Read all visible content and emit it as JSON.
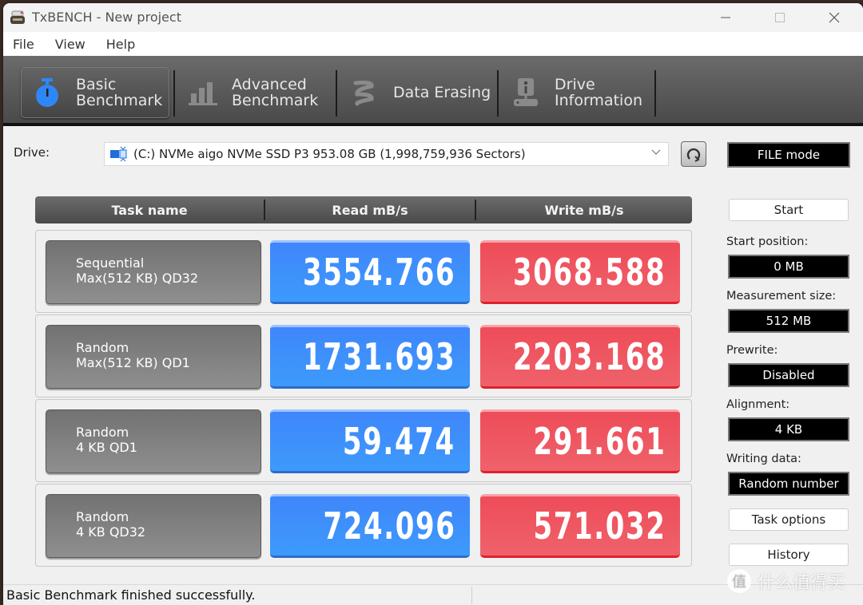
{
  "window": {
    "title": "TxBENCH - New project",
    "controls": {
      "minimize": "—",
      "maximize": "☐",
      "close": "✕"
    }
  },
  "menu": [
    "File",
    "View",
    "Help"
  ],
  "toolbar": {
    "tabs": [
      {
        "line1": "Basic",
        "line2": "Benchmark",
        "icon": "stopwatch-icon",
        "active": true
      },
      {
        "line1": "Advanced",
        "line2": "Benchmark",
        "icon": "bar-chart-icon",
        "active": false
      },
      {
        "line1": "Data Erasing",
        "line2": "",
        "icon": "eraser-icon",
        "active": false
      },
      {
        "line1": "Drive",
        "line2": "Information",
        "icon": "drive-info-icon",
        "active": false
      }
    ]
  },
  "drive": {
    "label": "Drive:",
    "selected": "(C:) NVMe aigo NVMe SSD P3  953.08 GB (1,998,759,936 Sectors)",
    "mode": "FILE mode"
  },
  "table": {
    "headers": {
      "task": "Task name",
      "read": "Read mB/s",
      "write": "Write mB/s"
    },
    "rows": [
      {
        "task_line1": "Sequential",
        "task_line2": "Max(512 KB) QD32",
        "read": "3554.766",
        "write": "3068.588"
      },
      {
        "task_line1": "Random",
        "task_line2": "Max(512 KB) QD1",
        "read": "1731.693",
        "write": "2203.168"
      },
      {
        "task_line1": "Random",
        "task_line2": "4 KB QD1",
        "read": "59.474",
        "write": "291.661"
      },
      {
        "task_line1": "Random",
        "task_line2": "4 KB QD32",
        "read": "724.096",
        "write": "571.032"
      }
    ]
  },
  "side_panel": {
    "start_label": "Start",
    "start_position": {
      "label": "Start position:",
      "value": "0 MB"
    },
    "measurement_size": {
      "label": "Measurement size:",
      "value": "512 MB"
    },
    "prewrite": {
      "label": "Prewrite:",
      "value": "Disabled"
    },
    "alignment": {
      "label": "Alignment:",
      "value": "4 KB"
    },
    "writing_data": {
      "label": "Writing data:",
      "value": "Random number"
    },
    "task_options_label": "Task options",
    "history_label": "History"
  },
  "status": {
    "text": "Basic Benchmark finished successfully."
  },
  "watermark": {
    "glyph": "值",
    "text": "什么值得买"
  },
  "colors": {
    "read": "#3f8cfb",
    "write": "#ee5560",
    "task": "#7f7f7f",
    "toolbar": "#5a5a5a",
    "active_icon": "#2f86f6"
  }
}
